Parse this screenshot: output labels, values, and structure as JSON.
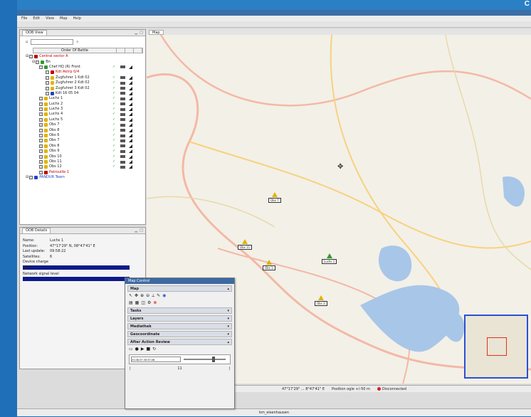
{
  "logo": {
    "text": "C"
  },
  "app": {
    "window_title": "",
    "menu": [
      "File",
      "Edit",
      "View",
      "Map",
      "Help"
    ]
  },
  "oob_panel": {
    "tab_label": "OOB View",
    "column_header": "Order Of Battle",
    "items": [
      {
        "label": "Central sector A",
        "depth": 0,
        "color": "red",
        "icon": "#c00000"
      },
      {
        "label": "Bn",
        "depth": 1,
        "color": "normal",
        "icon": "#2a9d2a"
      },
      {
        "label": "Chef HQ (R) Front",
        "depth": 2,
        "color": "normal",
        "icon": "#2a9d2a"
      },
      {
        "label": "Kdt Aktrp 0/4",
        "depth": 3,
        "color": "red",
        "icon": "#c00000"
      },
      {
        "label": "Zugfuhrer 1 Kdt 02",
        "depth": 3,
        "color": "normal",
        "icon": "#e0b400"
      },
      {
        "label": "Zugfuhrer 2 Kdt 02",
        "depth": 3,
        "color": "normal",
        "icon": "#e0b400"
      },
      {
        "label": "Zugfuhrer 3 Kdt 02",
        "depth": 3,
        "color": "normal",
        "icon": "#e0b400"
      },
      {
        "label": "Kdt 16 05 04",
        "depth": 3,
        "color": "normal",
        "icon": "#1d44c6"
      },
      {
        "label": "Luchs 1",
        "depth": 2,
        "color": "normal",
        "icon": "#e0b400"
      },
      {
        "label": "Luchs 2",
        "depth": 2,
        "color": "normal",
        "icon": "#e0b400"
      },
      {
        "label": "Luchs 3",
        "depth": 2,
        "color": "normal",
        "icon": "#e0b400"
      },
      {
        "label": "Luchs 4",
        "depth": 2,
        "color": "normal",
        "icon": "#e0b400"
      },
      {
        "label": "Luchs 5",
        "depth": 2,
        "color": "normal",
        "icon": "#e0b400"
      },
      {
        "label": "Obs 7",
        "depth": 2,
        "color": "normal",
        "icon": "#e0b400"
      },
      {
        "label": "Obs 8",
        "depth": 2,
        "color": "normal",
        "icon": "#e0b400"
      },
      {
        "label": "Obs 6",
        "depth": 2,
        "color": "normal",
        "icon": "#e0b400"
      },
      {
        "label": "Obs 7",
        "depth": 2,
        "color": "normal",
        "icon": "#e0b400"
      },
      {
        "label": "Obs 8",
        "depth": 2,
        "color": "normal",
        "icon": "#e0b400"
      },
      {
        "label": "Obs 9",
        "depth": 2,
        "color": "normal",
        "icon": "#e0b400"
      },
      {
        "label": "Obs 10",
        "depth": 2,
        "color": "normal",
        "icon": "#e0b400"
      },
      {
        "label": "Obs 11",
        "depth": 2,
        "color": "normal",
        "icon": "#e0b400"
      },
      {
        "label": "Obs 12",
        "depth": 2,
        "color": "normal",
        "icon": "#e0b400"
      },
      {
        "label": "Patrouille 1",
        "depth": 2,
        "color": "red",
        "icon": "#c00000"
      },
      {
        "label": "PANDUR Team",
        "depth": 0,
        "color": "blue",
        "icon": "#1d44c6"
      }
    ]
  },
  "details": {
    "tab_label": "OOB Details",
    "rows": [
      {
        "k": "Name:",
        "v": "Luchs 1"
      },
      {
        "k": "Position:",
        "v": "47°17'29\" N, 08°47'41\" E"
      },
      {
        "k": "Last update:",
        "v": "09:58:22"
      },
      {
        "k": "Satellites:",
        "v": "6"
      },
      {
        "k": "Device charge level:",
        "v": ""
      }
    ],
    "battery_label": "",
    "signal_label": "Network signal level"
  },
  "map": {
    "tab_label": "Map",
    "units": [
      {
        "name": "Luchs 1",
        "color": "#2a9d2a",
        "x": 0,
        "y": 0
      },
      {
        "name": "Obs 7",
        "color": "#e0b400",
        "x": 0,
        "y": 0
      },
      {
        "name": "Obs 11",
        "color": "#e0b400",
        "x": 0,
        "y": 0
      },
      {
        "name": "Obs 1",
        "color": "#e0b400",
        "x": 0,
        "y": 0
      },
      {
        "name": "Obs 3",
        "color": "#e0b400",
        "x": 0,
        "y": 0
      }
    ]
  },
  "palette": {
    "title": "Map Control",
    "sections": [
      "Map",
      "Tasks",
      "Layers",
      "Mediathek",
      "Geocoordinate",
      "After Action Review"
    ],
    "time_value": "21.06.07 20:37:28",
    "time_marker": "11"
  },
  "statusbar": {
    "coords": "47°17'29\" ... 8°47'41\" E",
    "scale": "Position ogle +/-50 m",
    "status": "Disconnected"
  },
  "bottombar": {
    "text": "km_eisenhausen"
  }
}
